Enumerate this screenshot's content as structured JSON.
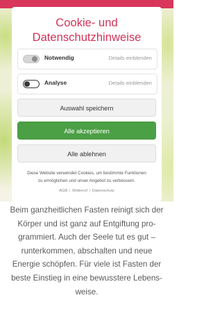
{
  "page": {
    "body_lines": [
      "Beim ganzheitlichen Fasten reinigt sich der",
      "Körper und ist ganz auf Entgiftung pro-",
      "grammiert. Auch der Seele tut es gut –",
      "runterkommen, abschalten und neue",
      "Energie schöpfen. Für viele ist Fasten der",
      "beste Einstieg in eine bewusstere Lebens-",
      "weise."
    ]
  },
  "cookie_dialog": {
    "title_lines": [
      "Cookie- und",
      "Datenschutzhinweise"
    ],
    "options": [
      {
        "label": "Notwendig",
        "details": "Details einblenden",
        "enabled": true
      },
      {
        "label": "Analyse",
        "details": "Details einblenden",
        "enabled": false
      }
    ],
    "buttons": {
      "save": "Auswahl speichern",
      "accept_all": "Alle akzeptieren",
      "decline_all": "Alle ablehnen"
    },
    "info_lines": [
      "Diese Website verwendet Cookies, um bestimmte Funktionen",
      "zu ermöglichen und unser Angebot zu verbessern."
    ],
    "footer_links": [
      "AGB",
      "Widerruf",
      "Datenschutz"
    ],
    "footer_separator": "|"
  },
  "colors": {
    "accent": "#cf3359",
    "accept_green": "#4b9f44",
    "brand_band": "#d9365c"
  }
}
